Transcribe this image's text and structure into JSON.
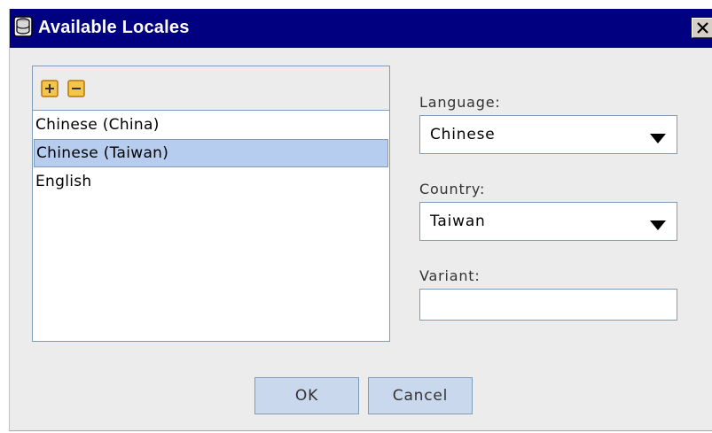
{
  "window": {
    "title": "Available Locales",
    "icon": "database-icon",
    "close_icon": "close-icon"
  },
  "locale_list": {
    "add_icon": "plus-icon",
    "remove_icon": "minus-icon",
    "items": [
      {
        "label": "Chinese (China)",
        "selected": false
      },
      {
        "label": "Chinese (Taiwan)",
        "selected": true
      },
      {
        "label": "English",
        "selected": false
      }
    ]
  },
  "fields": {
    "language": {
      "label": "Language:",
      "value": "Chinese"
    },
    "country": {
      "label": "Country:",
      "value": "Taiwan"
    },
    "variant": {
      "label": "Variant:",
      "value": ""
    }
  },
  "buttons": {
    "ok_label": "OK",
    "cancel_label": "Cancel"
  },
  "colors": {
    "titlebar": "#000080",
    "selection": "#b6cdef",
    "button": "#c9d8ec",
    "border": "#7f9db9",
    "tool_icon_fill": "#f5c44a"
  }
}
